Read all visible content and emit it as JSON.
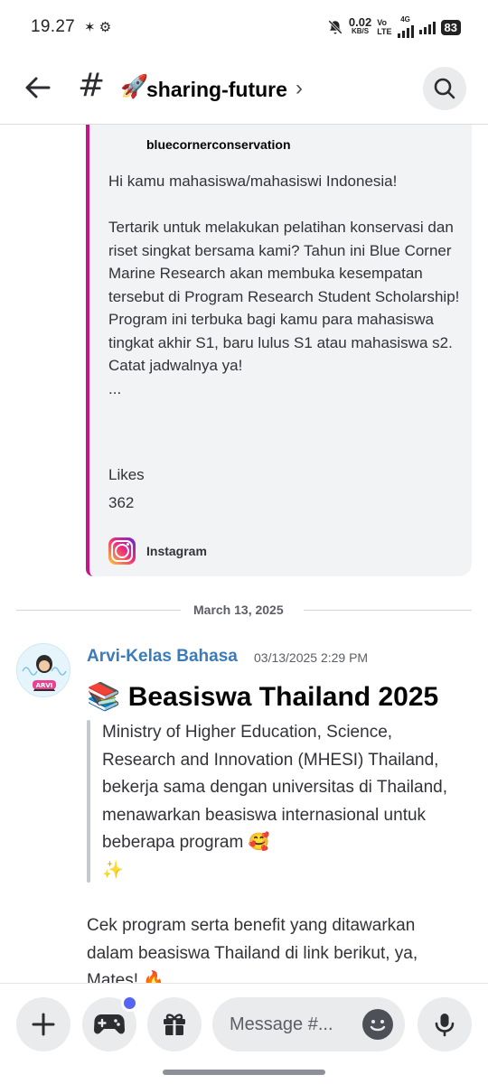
{
  "status_bar": {
    "time": "19.27",
    "left_icons": "✶ ⚙",
    "net_speed": "0.02",
    "net_unit": "KB/S",
    "volte_top": "Vo",
    "volte_bottom": "LTE",
    "network": "4G",
    "battery": "83"
  },
  "header": {
    "hash": "#",
    "rocket": "🚀",
    "channel_name": "sharing-future",
    "chevron": "›"
  },
  "embed": {
    "accent_color": "#c71585",
    "author": "bluecornerconservation",
    "description": "Hi kamu mahasiswa/mahasiswi Indonesia!\n\nTertarik untuk melakukan pelatihan konservasi dan riset singkat bersama kami? Tahun ini Blue Corner Marine Research akan membuka kesempatan tersebut di Program Research Student Scholarship!\nProgram ini terbuka bagi kamu para mahasiswa tingkat akhir S1, baru lulus S1 atau mahasiswa s2.\nCatat jadwalnya ya!\n...",
    "field_name": "Likes",
    "field_value": "362",
    "footer": "Instagram"
  },
  "divider": {
    "date": "March 13, 2025"
  },
  "message": {
    "author": "Arvi-Kelas Bahasa",
    "author_color": "#3a7bb8",
    "timestamp": "03/13/2025 2:29 PM",
    "avatar_label": "ARVI",
    "title_emoji": "📚",
    "title": "Beasiswa Thailand 2025",
    "quote": "Ministry of Higher Education, Science, Research and Innovation (MHESI) Thailand, bekerja sama dengan universitas di Thailand, menawarkan beasiswa internasional untuk beberapa program",
    "quote_emoji_1": "🥰",
    "quote_emoji_2": "✨",
    "body": "Cek program serta benefit yang ditawarkan dalam beasiswa Thailand di link berikut, ya, Mates!",
    "body_emoji": "🔥"
  },
  "composer": {
    "placeholder": "Message #...",
    "notification_color": "#5865f2"
  }
}
